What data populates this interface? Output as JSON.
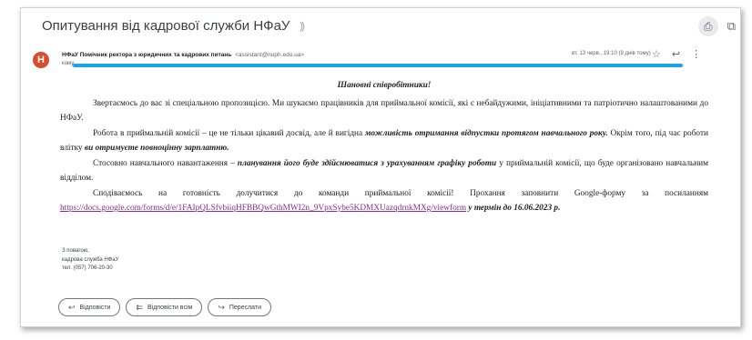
{
  "email": {
    "subject": "Опитування від кадрової служби НФаУ",
    "avatar_letter": "Н",
    "sender_name": "НФаУ Помічник ректора з юридичних та кадрових питань",
    "sender_email": "<assistant@nuph.edu.ua>",
    "to_label": "кому",
    "date": "вт, 13 черв., 19:10 (9 днів тому)"
  },
  "body": {
    "greeting": "Шановні співробітники!",
    "p1": "Звертаємось до вас зі спеціальною пропозицією. Ми шукаємо працівників для приймальної комісії, які є небайдужими, ініціативними та патріотично налаштованими до НФаУ.",
    "p2_start": "Робота в приймальній комісії – це не тільки цікавий досвід, але й вигідна",
    "p2_bold": "можливість отримання відпустки протягом навчального року.",
    "p2_mid": "Окрім того, під час роботи влітку",
    "p2_bold2": "ви отримуєте повноцінну зарплатню.",
    "p3_start": "Стосовно навчального навантаження –",
    "p3_bold": "планування його буде здійснюватися з урахуванням графіку роботи",
    "p3_end": "у приймальній комісії, що буде організовано навчальним відділом.",
    "p4_start": "Сподіваємось на готовність долучитися до команди приймальної комісії! Прохання заповнити Google-форму за посиланням",
    "p4_link": "https://docs.google.com/forms/d/e/1FAIpQLSfvbiiqHFBBQwGthMWI2n_9VpxSybe5KDMXUazqdrnkMXg/viewform",
    "p4_bold": "у термін до 16.06.2023 р."
  },
  "signature": {
    "line1": "З повагою,",
    "line2": "кадрова служба НФаУ",
    "line3": "тел. (057) 706-20-30"
  },
  "buttons": {
    "reply": "Відповісти",
    "reply_all": "Відповісти всім",
    "forward": "Переслати"
  },
  "colors": {
    "avatar": "#d94b2b",
    "redaction_line": "#1aa3ea",
    "link": "#8b2b8f"
  },
  "icons": [
    "label-icon",
    "print-icon",
    "open-new-window-icon",
    "star-icon",
    "reply-icon",
    "more-vert-icon",
    "reply-all-icon",
    "forward-icon"
  ]
}
